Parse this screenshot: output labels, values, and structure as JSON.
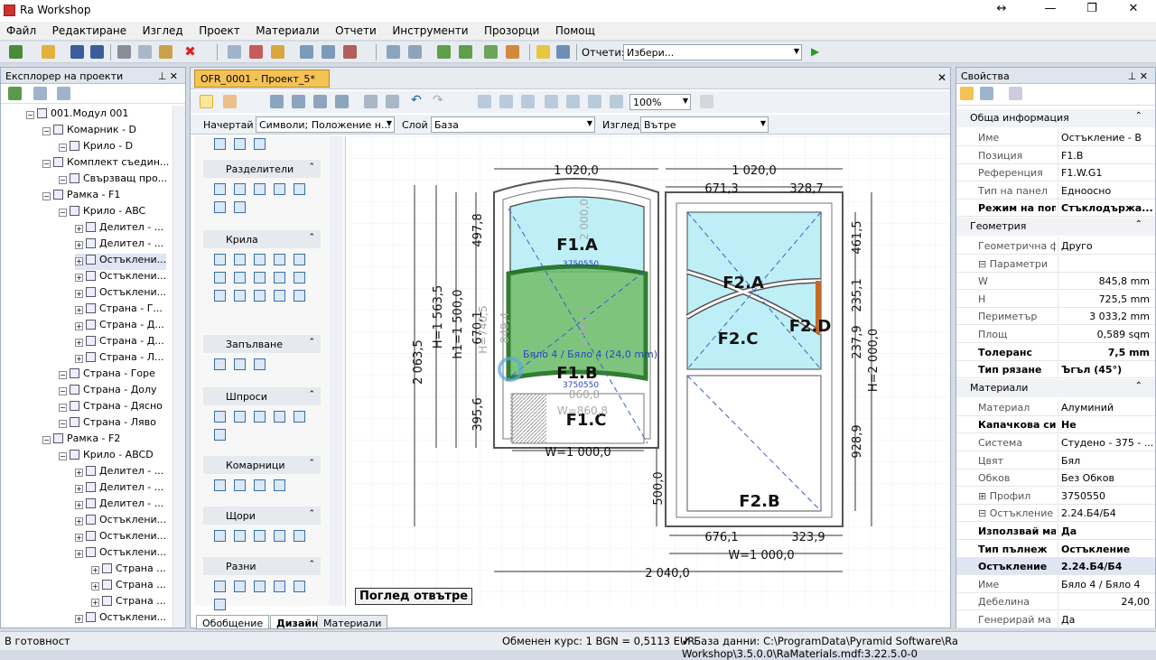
{
  "app": {
    "title": "Ra Workshop",
    "win_buttons": [
      "↔",
      "—",
      "❐",
      "✕"
    ]
  },
  "menu": [
    "Файл",
    "Редактиране",
    "Изглед",
    "Проект",
    "Материали",
    "Отчети",
    "Инструменти",
    "Прозорци",
    "Помощ"
  ],
  "toolbar": {
    "reports_label": "Отчети:",
    "reports_value": "Избери...",
    "play": "▶"
  },
  "explorer": {
    "title": "Експлорер на проекти",
    "pin": "⊥ ✕",
    "items": [
      {
        "label": "001.Модул 001",
        "indent": 0
      },
      {
        "label": "Комарник - D",
        "indent": 1
      },
      {
        "label": "Крило - D",
        "indent": 2
      },
      {
        "label": "Комплект съедин...",
        "indent": 1
      },
      {
        "label": "Свързващ про...",
        "indent": 2
      },
      {
        "label": "Рамка - F1",
        "indent": 1
      },
      {
        "label": "Крило - ABC",
        "indent": 2
      },
      {
        "label": "Делител - ...",
        "indent": 3
      },
      {
        "label": "Делител - ...",
        "indent": 3
      },
      {
        "label": "Остъклени...",
        "indent": 3
      },
      {
        "label": "Остъклени...",
        "indent": 3
      },
      {
        "label": "Остъклени...",
        "indent": 3
      },
      {
        "label": "Страна - Г...",
        "indent": 3
      },
      {
        "label": "Страна - Д...",
        "indent": 3
      },
      {
        "label": "Страна - Д...",
        "indent": 3
      },
      {
        "label": "Страна - Л...",
        "indent": 3
      },
      {
        "label": "Страна - Горе",
        "indent": 2
      },
      {
        "label": "Страна - Долу",
        "indent": 2
      },
      {
        "label": "Страна - Дясно",
        "indent": 2
      },
      {
        "label": "Страна - Ляво",
        "indent": 2
      },
      {
        "label": "Рамка - F2",
        "indent": 1
      },
      {
        "label": "Крило - ABCD",
        "indent": 2
      },
      {
        "label": "Делител - ...",
        "indent": 3
      },
      {
        "label": "Делител - ...",
        "indent": 3
      },
      {
        "label": "Делител - ...",
        "indent": 3
      },
      {
        "label": "Остъклени...",
        "indent": 3
      },
      {
        "label": "Остъклени...",
        "indent": 3
      },
      {
        "label": "Остъклени...",
        "indent": 3
      },
      {
        "label": "Страна ...",
        "indent": 4
      },
      {
        "label": "Страна ...",
        "indent": 4
      },
      {
        "label": "Страна ...",
        "indent": 4
      },
      {
        "label": "Остъклени...",
        "indent": 3
      }
    ]
  },
  "document": {
    "tab": "OFR_0001 - Проект_5*",
    "close": "✕",
    "zoom": "100%",
    "draw_label": "Начертай",
    "draw_value": "Символи; Положение н...",
    "layer_label": "Слой",
    "layer_value": "База",
    "view_label": "Изглед",
    "view_value": "Вътре",
    "bottom_tabs": [
      "Обобщение",
      "Дизайн",
      "Материали"
    ],
    "view_badge": "Поглед отвътре"
  },
  "palette": {
    "groups": [
      "Разделители",
      "Крила",
      "Запълване",
      "Шпроси",
      "Комарници",
      "Щори",
      "Разни"
    ]
  },
  "drawing": {
    "dims_top": [
      "1 020,0",
      "1 020,0"
    ],
    "dims_top2": [
      "671,3",
      "328,7"
    ],
    "dims_bottom": [
      "676,1",
      "323,9"
    ],
    "w_left": "W=1 000,0",
    "w_right": "W=1 000,0",
    "total": "2 040,0",
    "h_left": [
      "2 063,5",
      "H=1 563,5",
      "h1=1 500,0",
      "670,1",
      "497,8",
      "395,6",
      "500,0"
    ],
    "h_right": [
      "461,5",
      "235,1",
      "237,9",
      "928,9",
      "H=2 000,0"
    ],
    "labels": [
      "F1.A",
      "F1.B",
      "F1.C",
      "F2.A",
      "F2.C",
      "F2.D",
      "F2.B"
    ],
    "overlay": [
      "H=740,5",
      "849,4",
      "860,8",
      "W=860,8",
      "2 055,7",
      "2 000,0"
    ],
    "profile_code": "3750550",
    "tooltip": "Бяло 4 / Бяло 4 (24,0 mm)"
  },
  "properties": {
    "title": "Свойства",
    "sections": [
      {
        "name": "Обща информация",
        "rows": [
          {
            "k": "Име",
            "v": "Остъкление - В",
            "bold": false
          },
          {
            "k": "Позиция",
            "v": "F1.B",
            "bold": false
          },
          {
            "k": "Референция",
            "v": "F1.W.G1",
            "bold": false
          },
          {
            "k": "Тип на панел",
            "v": "Едноосно",
            "bold": false
          },
          {
            "k": "Режим на попра",
            "v": "Стъклодържа...",
            "bold": true
          }
        ]
      },
      {
        "name": "Геометрия",
        "rows": [
          {
            "k": "Геометрична фо",
            "v": "Друго",
            "bold": false
          },
          {
            "k": "⊟ Параметри",
            "v": "",
            "bold": false
          },
          {
            "k": "W",
            "v": "845,8 mm",
            "bold": false,
            "right": true
          },
          {
            "k": "H",
            "v": "725,5 mm",
            "bold": false,
            "right": true
          },
          {
            "k": "Периметър",
            "v": "3 033,2 mm",
            "bold": false,
            "right": true
          },
          {
            "k": "Площ",
            "v": "0,589 sqm",
            "bold": false,
            "right": true
          },
          {
            "k": "Толеранс",
            "v": "7,5 mm",
            "bold": true,
            "right": true
          },
          {
            "k": "Тип рязане",
            "v": "Ъгъл (45°)",
            "bold": true
          }
        ]
      },
      {
        "name": "Материали",
        "rows": [
          {
            "k": "Материал",
            "v": "Алуминий",
            "bold": false
          },
          {
            "k": "Капачкова сист",
            "v": "Не",
            "bold": true
          },
          {
            "k": "Система",
            "v": "Студено - 375 - ...",
            "bold": false
          },
          {
            "k": "Цвят",
            "v": "Бял",
            "bold": false
          },
          {
            "k": "Обков",
            "v": "Без Обков",
            "bold": false
          },
          {
            "k": "⊞ Профил",
            "v": "3750550",
            "bold": false
          },
          {
            "k": "⊟ Остъкление",
            "v": "2.24.Б4/Б4",
            "bold": false
          },
          {
            "k": "Използвай ма",
            "v": "Да",
            "bold": true
          },
          {
            "k": "Тип пълнеж",
            "v": "Остъкление",
            "bold": true
          },
          {
            "k": "Остъкление",
            "v": "2.24.Б4/Б4",
            "bold": true
          },
          {
            "k": "Име",
            "v": "Бяло 4 / Бяло 4",
            "bold": false
          },
          {
            "k": "Дебелина",
            "v": "24,00",
            "bold": false,
            "right": true
          },
          {
            "k": "Генерирай ма",
            "v": "Да",
            "bold": false
          },
          {
            "k": "Генерирай мате",
            "v": "Да",
            "bold": true
          }
        ]
      }
    ]
  },
  "status": {
    "left": "В готовност",
    "rate": "Обменен курс: 1 BGN = 0,5113 EUR",
    "db": "✔ База данни: C:\\ProgramData\\Pyramid Software\\Ra Workshop\\3.5.0.0\\RaMaterials.mdf:3.22.5.0-0"
  }
}
